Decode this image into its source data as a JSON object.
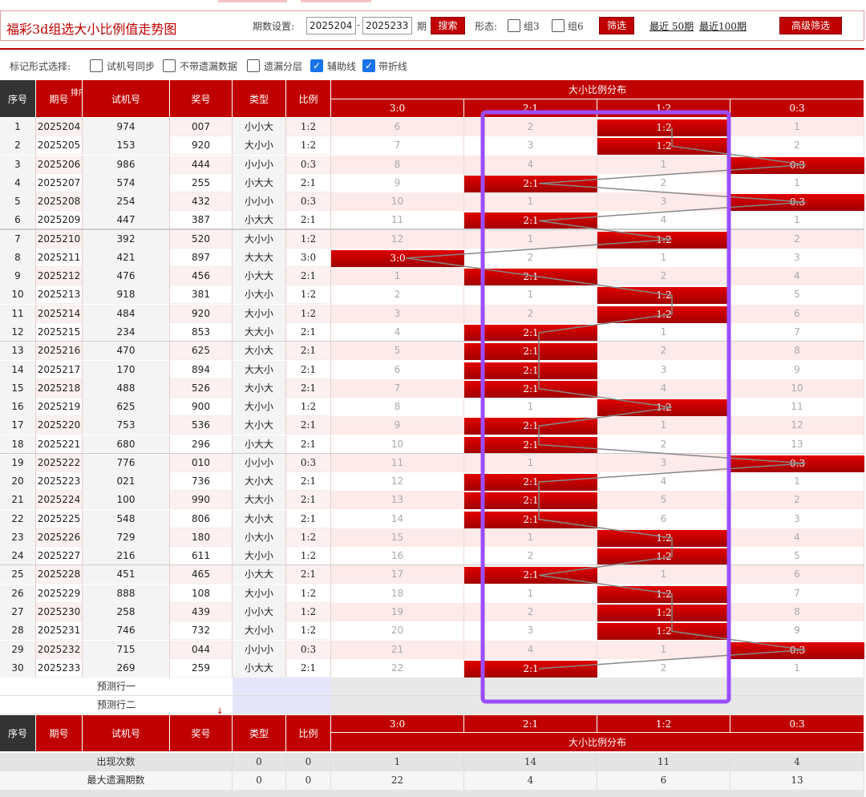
{
  "header": {
    "title": "福彩3d组选大小比例值走势图",
    "period_label": "期数设置:",
    "period_from": "2025204",
    "period_to": "2025233",
    "period_unit": "期",
    "search_label": "搜索",
    "shape_label": "形态:",
    "group3_label": "组3",
    "group6_label": "组6",
    "filter_label": "筛选",
    "recent50_label": "最近 50期",
    "recent100_label": "最近100期",
    "advanced_label": "高级筛选"
  },
  "markbar": {
    "label": "标记形式选择:",
    "options": [
      {
        "label": "试机号同步",
        "checked": false
      },
      {
        "label": "不带遗漏数据",
        "checked": false
      },
      {
        "label": "遗漏分层",
        "checked": false
      },
      {
        "label": "辅助线",
        "checked": true
      },
      {
        "label": "带折线",
        "checked": true
      }
    ]
  },
  "table": {
    "headers": {
      "seq": "序号",
      "issue": "期号",
      "sort": "排序",
      "test": "试机号",
      "prize": "奖号",
      "type": "类型",
      "ratio": "比例",
      "dist": "大小比例分布"
    },
    "dist_cols": [
      "3:0",
      "2:1",
      "1:2",
      "0:3"
    ],
    "rows": [
      {
        "seq": "1",
        "issue": "2025204",
        "test": "974",
        "prize": "007",
        "type": "小小大",
        "ratio": "1:2",
        "hit": 2,
        "cells": [
          "6",
          "2",
          "1:2",
          "1"
        ]
      },
      {
        "seq": "2",
        "issue": "2025205",
        "test": "153",
        "prize": "920",
        "type": "大小小",
        "ratio": "1:2",
        "hit": 2,
        "cells": [
          "7",
          "3",
          "1:2",
          "2"
        ]
      },
      {
        "seq": "3",
        "issue": "2025206",
        "test": "986",
        "prize": "444",
        "type": "小小小",
        "ratio": "0:3",
        "hit": 3,
        "cells": [
          "8",
          "4",
          "1",
          "0:3"
        ]
      },
      {
        "seq": "4",
        "issue": "2025207",
        "test": "574",
        "prize": "255",
        "type": "小大大",
        "ratio": "2:1",
        "hit": 1,
        "cells": [
          "9",
          "2:1",
          "2",
          "1"
        ]
      },
      {
        "seq": "5",
        "issue": "2025208",
        "test": "254",
        "prize": "432",
        "type": "小小小",
        "ratio": "0:3",
        "hit": 3,
        "cells": [
          "10",
          "1",
          "3",
          "0:3"
        ]
      },
      {
        "seq": "6",
        "issue": "2025209",
        "test": "447",
        "prize": "387",
        "type": "小大大",
        "ratio": "2:1",
        "hit": 1,
        "cells": [
          "11",
          "2:1",
          "4",
          "1"
        ]
      },
      {
        "seq": "7",
        "issue": "2025210",
        "test": "392",
        "prize": "520",
        "type": "大小小",
        "ratio": "1:2",
        "hit": 2,
        "cells": [
          "12",
          "1",
          "1:2",
          "2"
        ]
      },
      {
        "seq": "8",
        "issue": "2025211",
        "test": "421",
        "prize": "897",
        "type": "大大大",
        "ratio": "3:0",
        "hit": 0,
        "cells": [
          "3:0",
          "2",
          "1",
          "3"
        ]
      },
      {
        "seq": "9",
        "issue": "2025212",
        "test": "476",
        "prize": "456",
        "type": "小大大",
        "ratio": "2:1",
        "hit": 1,
        "cells": [
          "1",
          "2:1",
          "2",
          "4"
        ]
      },
      {
        "seq": "10",
        "issue": "2025213",
        "test": "918",
        "prize": "381",
        "type": "小大小",
        "ratio": "1:2",
        "hit": 2,
        "cells": [
          "2",
          "1",
          "1:2",
          "5"
        ]
      },
      {
        "seq": "11",
        "issue": "2025214",
        "test": "484",
        "prize": "920",
        "type": "大小小",
        "ratio": "1:2",
        "hit": 2,
        "cells": [
          "3",
          "2",
          "1:2",
          "6"
        ]
      },
      {
        "seq": "12",
        "issue": "2025215",
        "test": "234",
        "prize": "853",
        "type": "大大小",
        "ratio": "2:1",
        "hit": 1,
        "cells": [
          "4",
          "2:1",
          "1",
          "7"
        ]
      },
      {
        "seq": "13",
        "issue": "2025216",
        "test": "470",
        "prize": "625",
        "type": "大小大",
        "ratio": "2:1",
        "hit": 1,
        "cells": [
          "5",
          "2:1",
          "2",
          "8"
        ]
      },
      {
        "seq": "14",
        "issue": "2025217",
        "test": "170",
        "prize": "894",
        "type": "大大小",
        "ratio": "2:1",
        "hit": 1,
        "cells": [
          "6",
          "2:1",
          "3",
          "9"
        ]
      },
      {
        "seq": "15",
        "issue": "2025218",
        "test": "488",
        "prize": "526",
        "type": "大小大",
        "ratio": "2:1",
        "hit": 1,
        "cells": [
          "7",
          "2:1",
          "4",
          "10"
        ]
      },
      {
        "seq": "16",
        "issue": "2025219",
        "test": "625",
        "prize": "900",
        "type": "大小小",
        "ratio": "1:2",
        "hit": 2,
        "cells": [
          "8",
          "1",
          "1:2",
          "11"
        ]
      },
      {
        "seq": "17",
        "issue": "2025220",
        "test": "753",
        "prize": "536",
        "type": "大小大",
        "ratio": "2:1",
        "hit": 1,
        "cells": [
          "9",
          "2:1",
          "1",
          "12"
        ]
      },
      {
        "seq": "18",
        "issue": "2025221",
        "test": "680",
        "prize": "296",
        "type": "小大大",
        "ratio": "2:1",
        "hit": 1,
        "cells": [
          "10",
          "2:1",
          "2",
          "13"
        ]
      },
      {
        "seq": "19",
        "issue": "2025222",
        "test": "776",
        "prize": "010",
        "type": "小小小",
        "ratio": "0:3",
        "hit": 3,
        "cells": [
          "11",
          "1",
          "3",
          "0:3"
        ]
      },
      {
        "seq": "20",
        "issue": "2025223",
        "test": "021",
        "prize": "736",
        "type": "大小大",
        "ratio": "2:1",
        "hit": 1,
        "cells": [
          "12",
          "2:1",
          "4",
          "1"
        ]
      },
      {
        "seq": "21",
        "issue": "2025224",
        "test": "100",
        "prize": "990",
        "type": "大大小",
        "ratio": "2:1",
        "hit": 1,
        "cells": [
          "13",
          "2:1",
          "5",
          "2"
        ]
      },
      {
        "seq": "22",
        "issue": "2025225",
        "test": "548",
        "prize": "806",
        "type": "大小大",
        "ratio": "2:1",
        "hit": 1,
        "cells": [
          "14",
          "2:1",
          "6",
          "3"
        ]
      },
      {
        "seq": "23",
        "issue": "2025226",
        "test": "729",
        "prize": "180",
        "type": "小大小",
        "ratio": "1:2",
        "hit": 2,
        "cells": [
          "15",
          "1",
          "1:2",
          "4"
        ]
      },
      {
        "seq": "24",
        "issue": "2025227",
        "test": "216",
        "prize": "611",
        "type": "大小小",
        "ratio": "1:2",
        "hit": 2,
        "cells": [
          "16",
          "2",
          "1:2",
          "5"
        ]
      },
      {
        "seq": "25",
        "issue": "2025228",
        "test": "451",
        "prize": "465",
        "type": "小大大",
        "ratio": "2:1",
        "hit": 1,
        "cells": [
          "17",
          "2:1",
          "1",
          "6"
        ]
      },
      {
        "seq": "26",
        "issue": "2025229",
        "test": "888",
        "prize": "108",
        "type": "大小小",
        "ratio": "1:2",
        "hit": 2,
        "cells": [
          "18",
          "1",
          "1:2",
          "7"
        ]
      },
      {
        "seq": "27",
        "issue": "2025230",
        "test": "258",
        "prize": "439",
        "type": "小小大",
        "ratio": "1:2",
        "hit": 2,
        "cells": [
          "19",
          "2",
          "1:2",
          "8"
        ]
      },
      {
        "seq": "28",
        "issue": "2025231",
        "test": "746",
        "prize": "732",
        "type": "大小小",
        "ratio": "1:2",
        "hit": 2,
        "cells": [
          "20",
          "3",
          "1:2",
          "9"
        ]
      },
      {
        "seq": "29",
        "issue": "2025232",
        "test": "715",
        "prize": "044",
        "type": "小小小",
        "ratio": "0:3",
        "hit": 3,
        "cells": [
          "21",
          "4",
          "1",
          "0:3"
        ]
      },
      {
        "seq": "30",
        "issue": "2025233",
        "test": "269",
        "prize": "259",
        "type": "小大大",
        "ratio": "2:1",
        "hit": 1,
        "cells": [
          "22",
          "2:1",
          "2",
          "1"
        ]
      }
    ],
    "forecast": [
      "预测行一",
      "预测行二"
    ],
    "stats": [
      {
        "label": "出现次数",
        "type": "0",
        "ratio": "0",
        "cells": [
          "1",
          "14",
          "11",
          "4"
        ]
      },
      {
        "label": "最大遗漏期数",
        "type": "0",
        "ratio": "0",
        "cells": [
          "22",
          "4",
          "6",
          "13"
        ]
      }
    ]
  },
  "colors": {
    "accent": "#c00000",
    "highlight_box": "#9b4dff",
    "row_shade": "#fde8e8"
  }
}
